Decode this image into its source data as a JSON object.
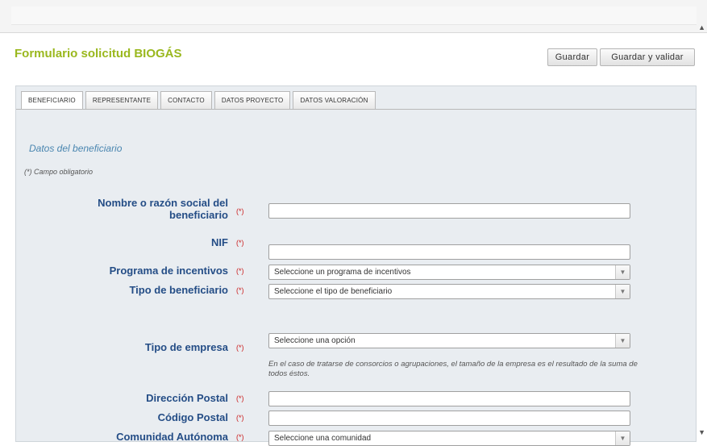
{
  "page": {
    "title": "Formulario solicitud BIOGÁS",
    "title_color": "#9ab81e"
  },
  "buttons": {
    "save": "Guardar",
    "save_validate": "Guardar y validar"
  },
  "tabs": [
    {
      "label": "BENEFICIARIO",
      "active": true
    },
    {
      "label": "REPRESENTANTE",
      "active": false
    },
    {
      "label": "CONTACTO",
      "active": false
    },
    {
      "label": "DATOS PROYECTO",
      "active": false
    },
    {
      "label": "DATOS VALORACIÓN",
      "active": false
    }
  ],
  "form": {
    "section_title": "Datos del beneficiario",
    "required_note": "(*) Campo obligatorio",
    "required_marker": "(*)",
    "label_color": "#244d86",
    "fields": {
      "nombre": {
        "label_line1": "Nombre o razón social del",
        "label_line2": "beneficiario",
        "value": ""
      },
      "nif": {
        "label": "NIF",
        "value": ""
      },
      "programa": {
        "label": "Programa de incentivos",
        "selected": "Seleccione un programa de incentivos"
      },
      "tipo_beneficiario": {
        "label": "Tipo de beneficiario",
        "selected": "Seleccione el tipo de beneficiario"
      },
      "tipo_empresa": {
        "label": "Tipo de empresa",
        "selected": "Seleccione una opción",
        "help": "En el caso de tratarse de consorcios o agrupaciones, el tamaño de la empresa es el resultado de la suma de todos éstos."
      },
      "direccion": {
        "label": "Dirección Postal",
        "value": ""
      },
      "codigo_postal": {
        "label": "Código Postal",
        "value": ""
      },
      "comunidad": {
        "label": "Comunidad Autónoma",
        "selected": "Seleccione una comunidad"
      }
    }
  }
}
